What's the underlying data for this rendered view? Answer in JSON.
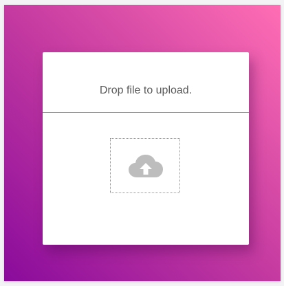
{
  "upload": {
    "prompt": "Drop file to upload.",
    "icon": "cloud-upload-icon"
  },
  "colors": {
    "gradient_start": "#ff6eb4",
    "gradient_mid": "#c43aa0",
    "gradient_end": "#8a0b9c",
    "card": "#ffffff",
    "icon": "#bdbdbd"
  }
}
